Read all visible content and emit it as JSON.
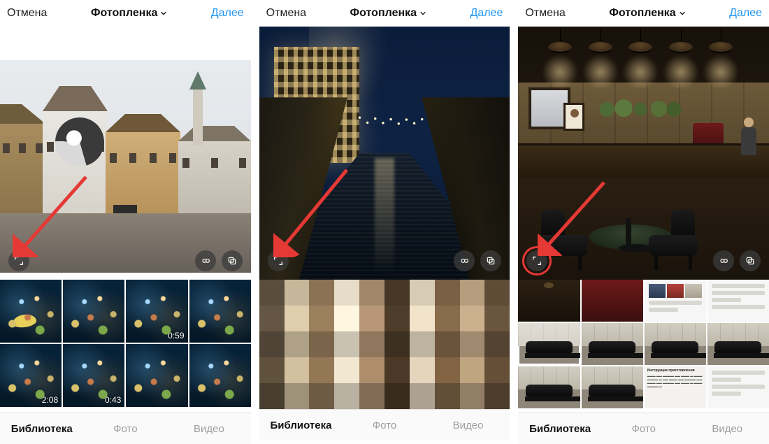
{
  "colors": {
    "accent": "#2196f3",
    "annotation": "#e53935",
    "text": "#222222",
    "muted": "#9e9e9e"
  },
  "screens": [
    {
      "header": {
        "cancel": "Отмена",
        "title": "Фотопленка",
        "next": "Далее"
      },
      "tabs": {
        "library": "Библиотека",
        "photo": "Фото",
        "video": "Видео",
        "active": "library"
      },
      "overlay_buttons": {
        "expand": "expand-crop-icon",
        "infinity": "boomerang-icon",
        "layout": "multi-select-icon"
      },
      "annotation": {
        "type": "arrow",
        "target": "expand-button"
      },
      "thumbnails": [
        {
          "kind": "photo"
        },
        {
          "kind": "photo"
        },
        {
          "kind": "video",
          "duration": "0:59"
        },
        {
          "kind": "photo"
        },
        {
          "kind": "video",
          "duration": "2:08"
        },
        {
          "kind": "video",
          "duration": "0:43"
        },
        {
          "kind": "photo"
        },
        {
          "kind": "photo"
        }
      ],
      "preview_fit": "letterbox-horizontal"
    },
    {
      "header": {
        "cancel": "Отмена",
        "title": "Фотопленка",
        "next": "Далее"
      },
      "tabs": {
        "library": "Библиотека",
        "photo": "Фото",
        "video": "Видео",
        "active": "library"
      },
      "overlay_buttons": {
        "expand": "expand-crop-icon",
        "infinity": "boomerang-icon",
        "layout": "multi-select-icon"
      },
      "annotation": {
        "type": "arrow",
        "target": "expand-button"
      },
      "preview_fit": "fill",
      "grid_blurred": true
    },
    {
      "header": {
        "cancel": "Отмена",
        "title": "Фотопленка",
        "next": "Далее"
      },
      "tabs": {
        "library": "Библиотека",
        "photo": "Фото",
        "video": "Видео",
        "active": "library"
      },
      "overlay_buttons": {
        "expand": "expand-crop-icon",
        "infinity": "boomerang-icon",
        "layout": "multi-select-icon"
      },
      "annotation": {
        "type": "arrow+circle",
        "target": "expand-button"
      },
      "preview_fit": "fill",
      "thumbnails": [
        {
          "kind": "photo",
          "variant": "cafe"
        },
        {
          "kind": "photo",
          "variant": "cafe"
        },
        {
          "kind": "photo",
          "variant": "screenshot"
        },
        {
          "kind": "photo",
          "variant": "screenshot"
        },
        {
          "kind": "photo",
          "variant": "car",
          "selected": true
        },
        {
          "kind": "photo",
          "variant": "car"
        },
        {
          "kind": "photo",
          "variant": "car"
        },
        {
          "kind": "photo",
          "variant": "car"
        },
        {
          "kind": "photo",
          "variant": "car"
        },
        {
          "kind": "photo",
          "variant": "car"
        },
        {
          "kind": "photo",
          "variant": "doc",
          "doc_title": "Инструкция приготовления"
        },
        {
          "kind": "photo",
          "variant": "screenshot"
        }
      ]
    }
  ]
}
